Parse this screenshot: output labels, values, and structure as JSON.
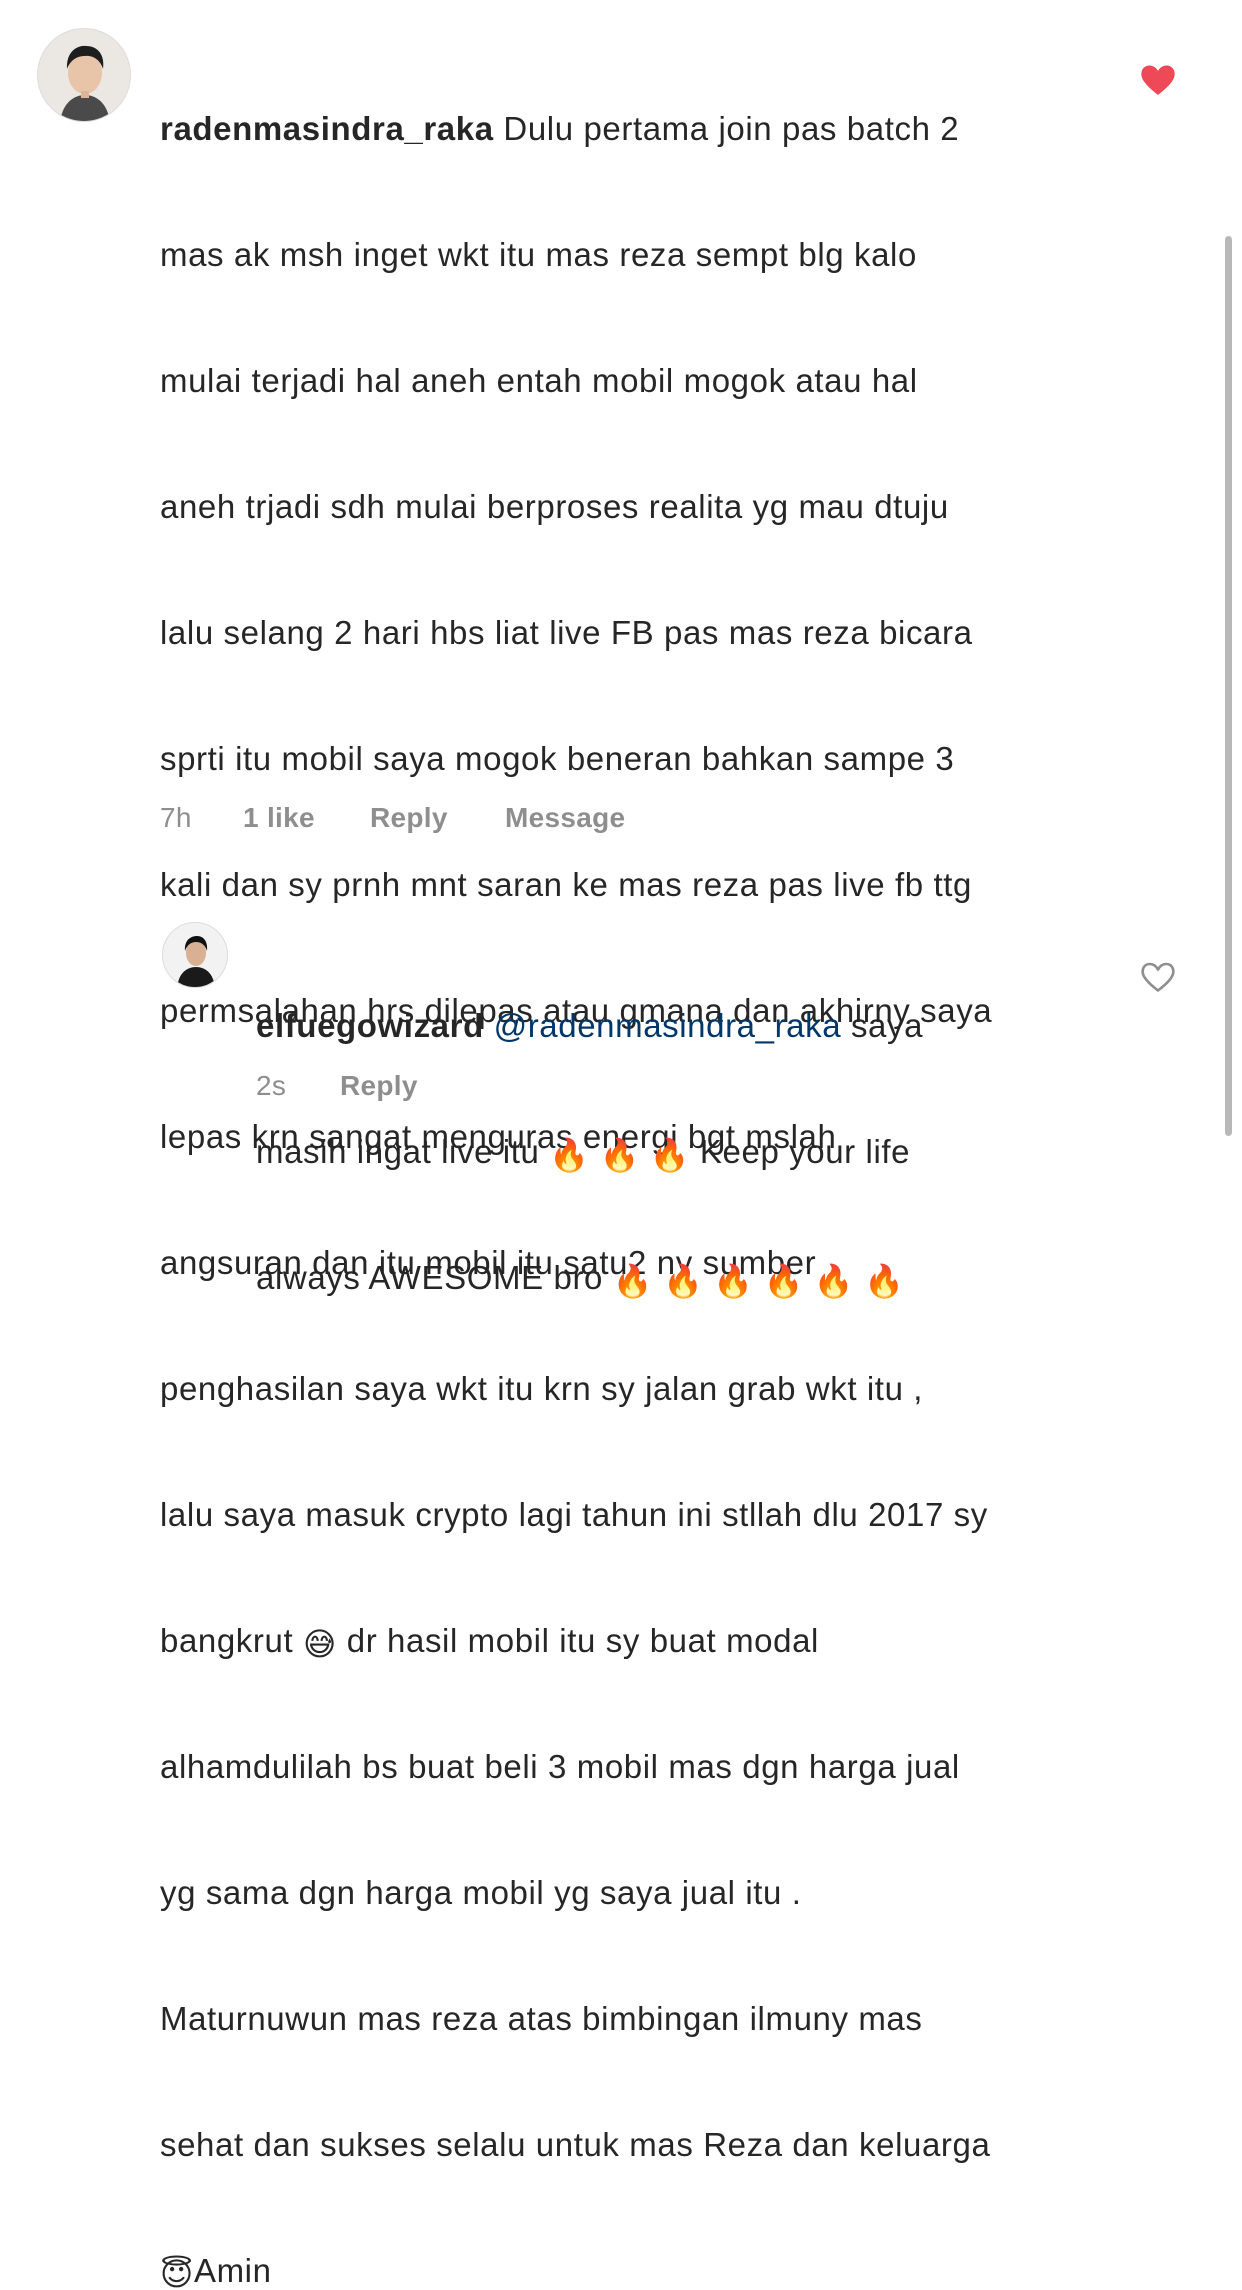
{
  "comments": [
    {
      "username": "radenmasindra_raka",
      "text_lines": [
        " Dulu pertama join pas batch 2",
        "mas ak msh inget wkt itu mas reza sempt blg kalo",
        "mulai terjadi hal aneh entah mobil mogok atau hal",
        "aneh trjadi sdh mulai berproses realita yg mau dtuju",
        "lalu selang 2 hari hbs liat live FB pas mas reza bicara",
        "sprti itu mobil saya mogok beneran bahkan sampe 3",
        "kali dan sy prnh mnt saran ke mas reza pas live fb ttg",
        "permsalahan hrs dilepas atau gmana dan akhirny saya",
        "lepas krn sangat menguras energi bgt mslah",
        "angsuran dan itu mobil itu satu2 ny sumber",
        "penghasilan saya wkt itu krn sy jalan grab wkt itu ,",
        "lalu saya masuk crypto lagi tahun ini stllah dlu 2017 sy"
      ],
      "emoji_line_1_before": "bangkrut ",
      "emoji_line_1_emoji": "😅",
      "emoji_line_1_after": " dr hasil mobil itu sy buat modal",
      "text_lines_2": [
        "alhamdulilah bs buat beli 3 mobil mas dgn harga jual",
        "yg sama dgn harga mobil yg saya jual itu .",
        "Maturnuwun mas reza atas bimbingan ilmuny mas",
        "sehat dan sukses selalu untuk mas Reza dan keluarga"
      ],
      "last_line_emoji": "😇",
      "last_line_text": "Amin",
      "time": "7h",
      "likes": "1 like",
      "reply_label": "Reply",
      "message_label": "Message",
      "liked": true,
      "heart_color": "#ed4956"
    },
    {
      "username": "elfuegowizard",
      "mention": "@radenmasindra_raka",
      "line1_after_mention": " saya",
      "line2_before": "masih ingat live itu ",
      "fire_emoji": "🔥",
      "line2_after": " Keep your life",
      "line3_before": "always AWESOME bro ",
      "time": "2s",
      "reply_label": "Reply",
      "liked": false
    }
  ],
  "colors": {
    "text": "#262626",
    "meta": "#8e8e8e",
    "mention": "#00376b",
    "like_red": "#ed4956"
  }
}
